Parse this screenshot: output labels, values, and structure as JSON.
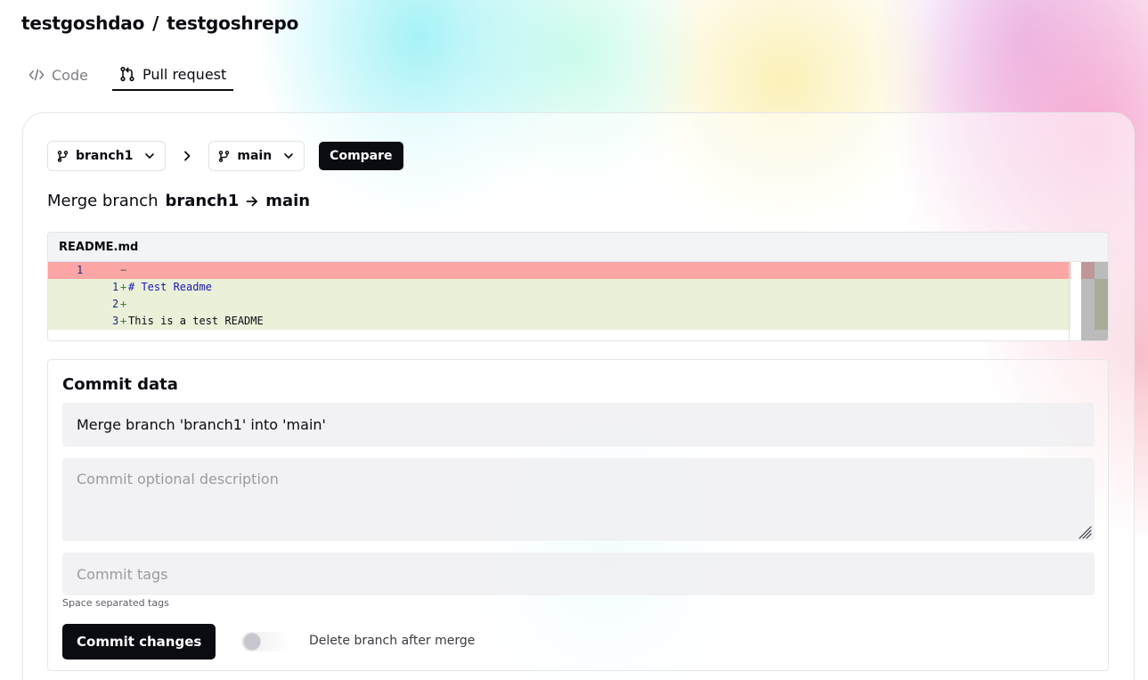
{
  "repo": {
    "owner": "testgoshdao",
    "separator": "/",
    "name": "testgoshrepo"
  },
  "tabs": [
    {
      "label": "Code",
      "icon": "code-icon",
      "active": false
    },
    {
      "label": "Pull request",
      "icon": "pull-request-icon",
      "active": true
    }
  ],
  "compare": {
    "from_branch": "branch1",
    "to_branch": "main",
    "compare_label": "Compare"
  },
  "merge": {
    "prefix": "Merge branch",
    "from": "branch1",
    "to": "main"
  },
  "diff": {
    "filename": "README.md",
    "lines": [
      {
        "type": "del",
        "old": "1",
        "new": "",
        "sign": "−",
        "code": ""
      },
      {
        "type": "add",
        "old": "",
        "new": "1",
        "sign": "+",
        "code": "# Test Readme"
      },
      {
        "type": "add",
        "old": "",
        "new": "2",
        "sign": "+",
        "code": ""
      },
      {
        "type": "add",
        "old": "",
        "new": "3",
        "sign": "+",
        "code": "This is a test README"
      }
    ]
  },
  "commit": {
    "title": "Commit data",
    "message_value": "Merge branch 'branch1' into 'main'",
    "description_placeholder": "Commit optional description",
    "tags_placeholder": "Commit tags",
    "tags_hint": "Space separated tags",
    "submit_label": "Commit changes",
    "delete_branch_label": "Delete branch after merge",
    "delete_branch_enabled": false
  },
  "colors": {
    "primary": "#0b0b12",
    "deleted_line": "#fba5a5",
    "added_line": "#ebf0d9"
  }
}
